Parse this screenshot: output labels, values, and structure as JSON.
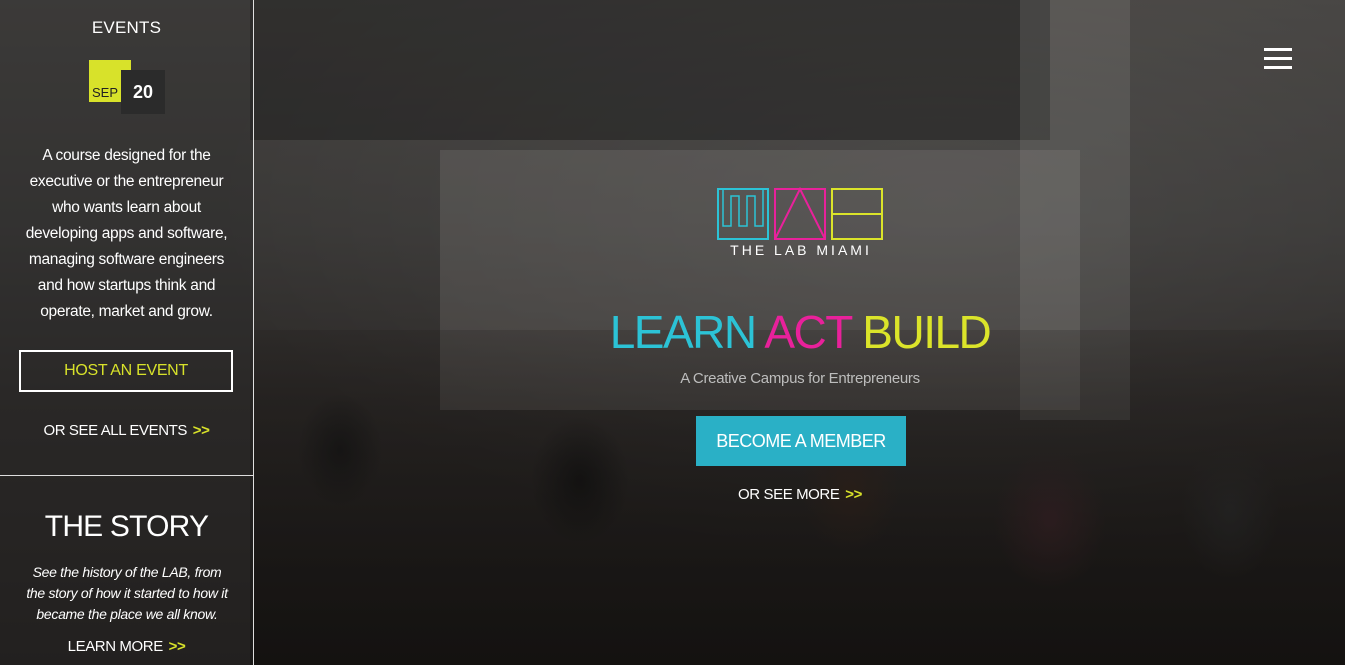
{
  "sidebar": {
    "events": {
      "title": "EVENTS",
      "date_month": "SEP",
      "date_day": "20",
      "description": "A course designed for the executive or the entrepreneur who wants learn about developing apps and software, managing software engineers and how startups think and operate, market and grow.",
      "host_button_label": "HOST AN EVENT",
      "see_all_label": "OR SEE ALL EVENTS",
      "arrows": ">>"
    },
    "story": {
      "title": "THE STORY",
      "description": "See the history of the LAB, from the story of how it started to how it became the place we all know.",
      "learn_more_label": "LEARN MORE",
      "arrows": ">>"
    }
  },
  "header": {
    "menu_icon": "hamburger-icon"
  },
  "hero": {
    "logo_text": "THE LAB MIAMI",
    "tagline": {
      "learn": "LEARN",
      "act": "ACT",
      "build": "BUILD"
    },
    "subtitle": "A Creative Campus for Entrepreneurs",
    "cta_label": "BECOME A MEMBER",
    "see_more_label": "OR SEE MORE",
    "arrows": ">>"
  },
  "colors": {
    "accent_yellow": "#d8e22a",
    "accent_cyan": "#2cc3d6",
    "accent_magenta": "#e8219b",
    "button_teal": "#2ab0c6"
  }
}
